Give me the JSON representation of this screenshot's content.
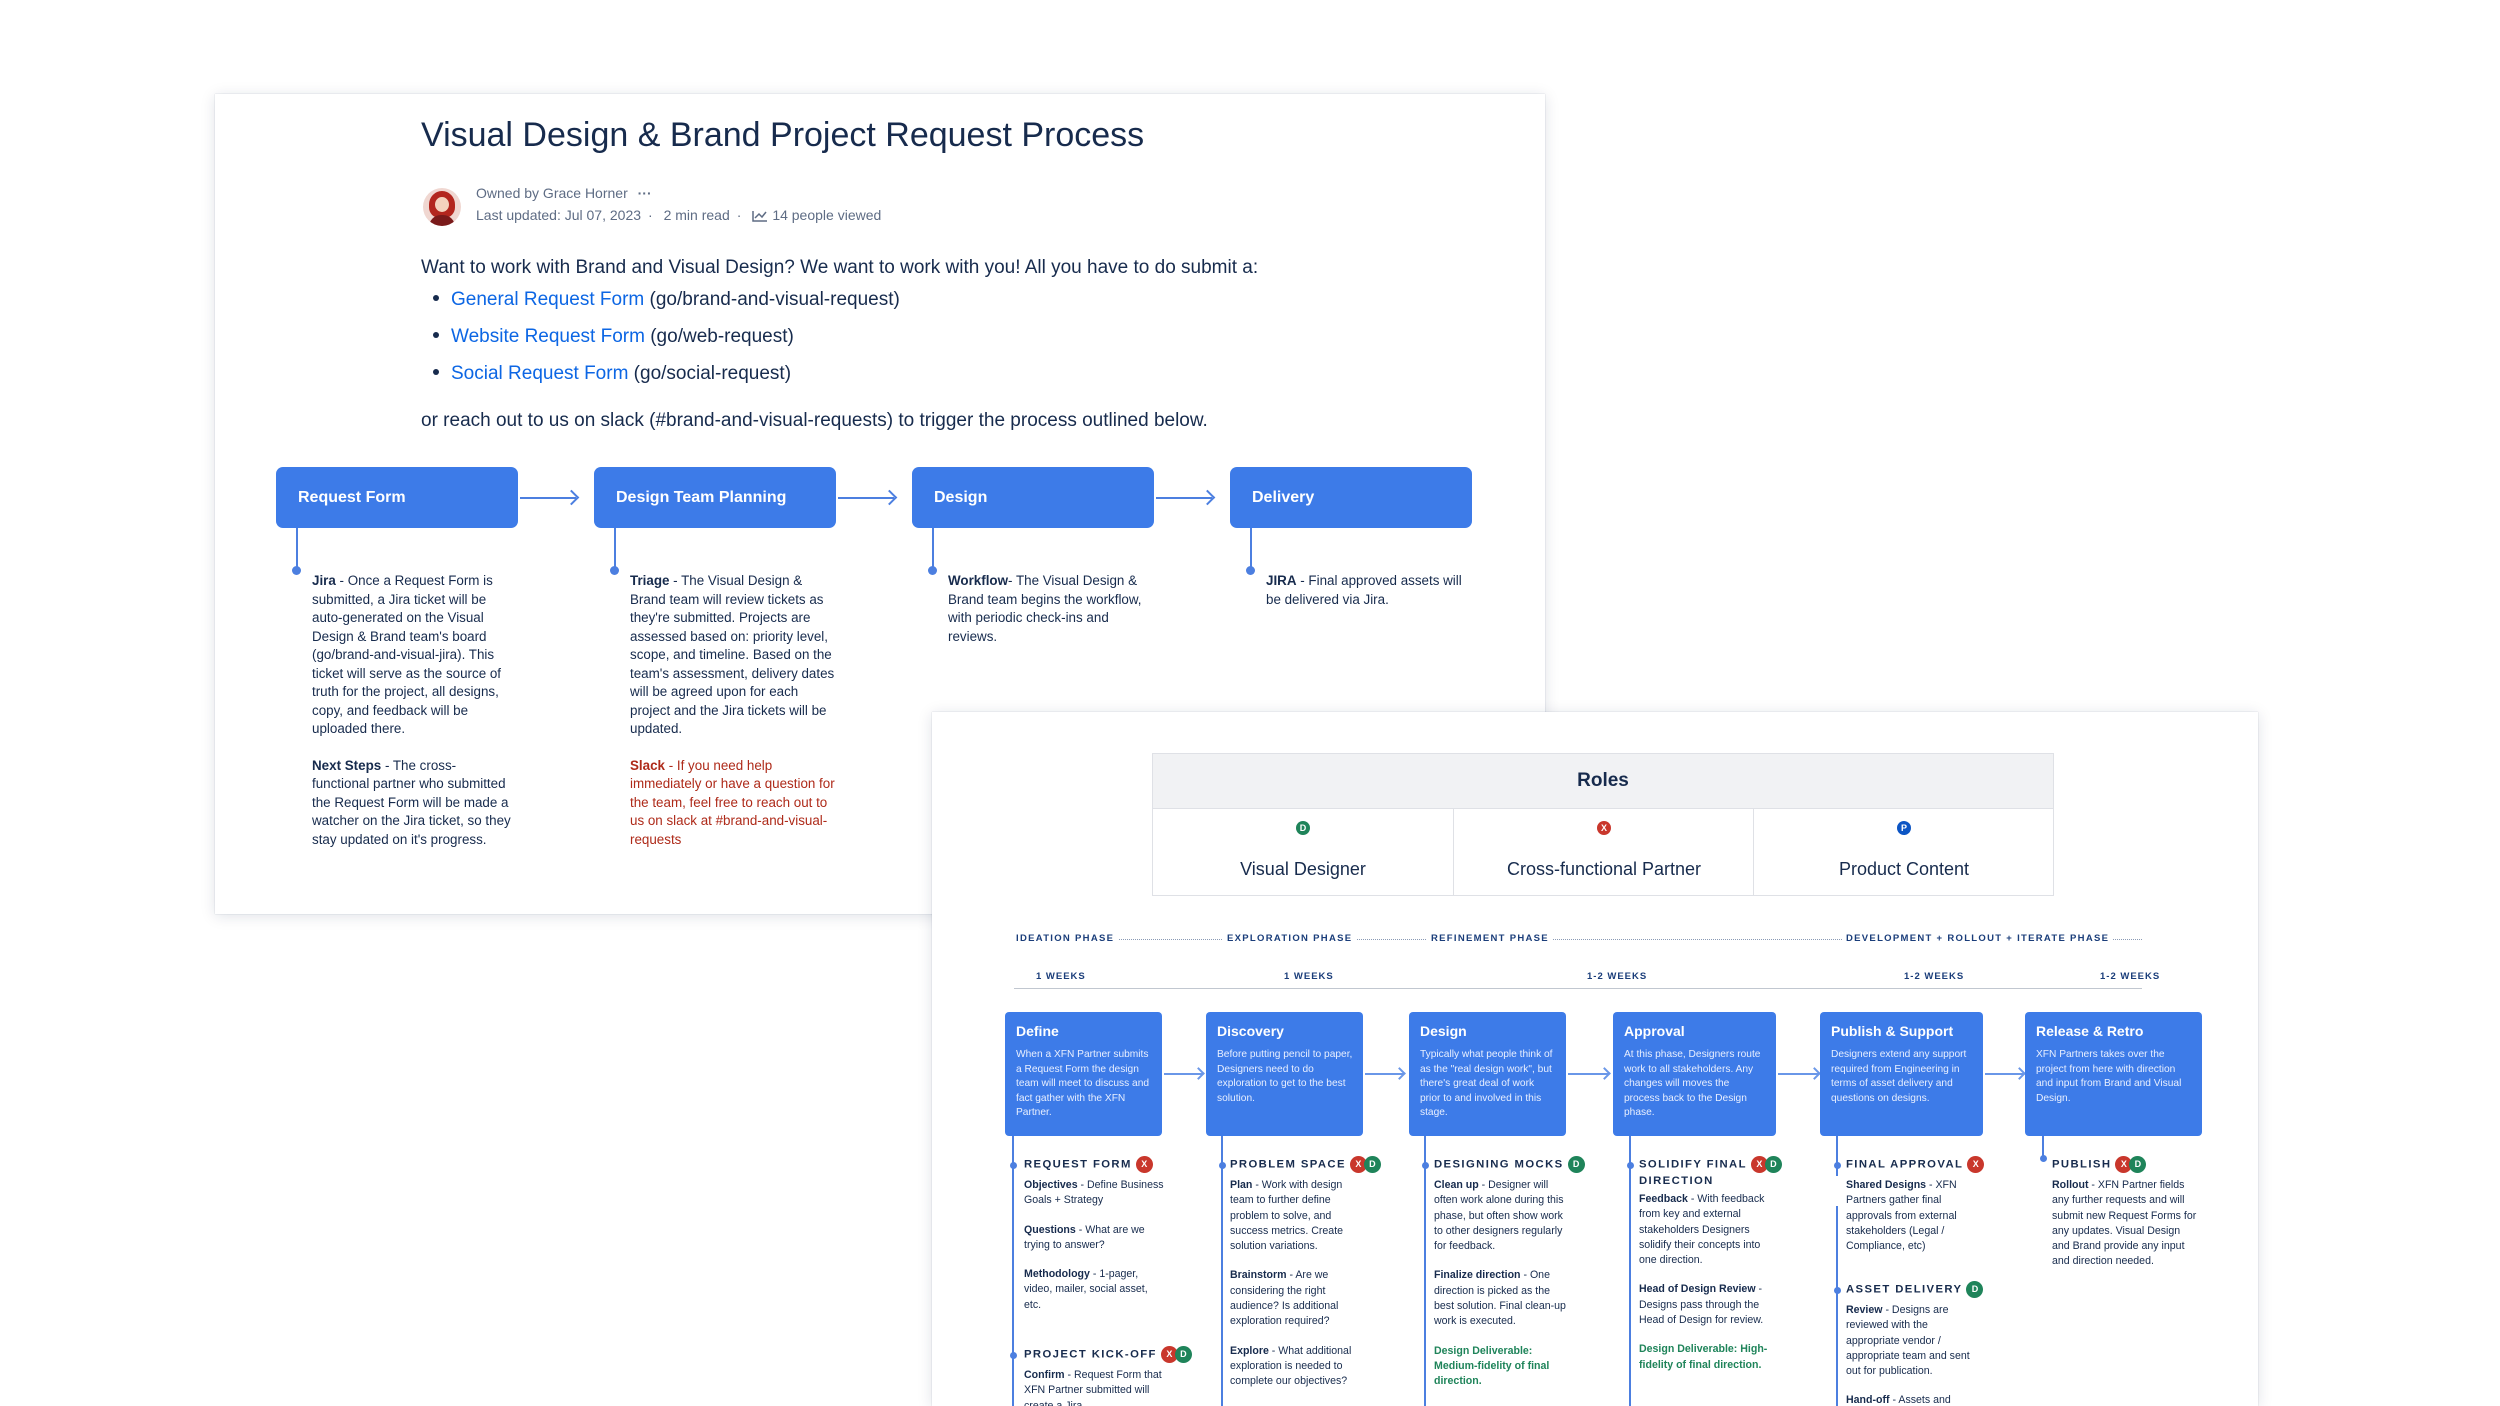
{
  "doc": {
    "title": "Visual Design & Brand Project Request Process",
    "owner": "Owned by Grace Horner",
    "owner_menu": "···",
    "updated": "Last updated: Jul 07, 2023",
    "read_time": "2 min read",
    "viewed": "14 people viewed",
    "intro": "Want to work with Brand and Visual Design? We want to work with you! All you have to do submit a:",
    "links": [
      {
        "label": "General Request Form",
        "suffix": " (go/brand-and-visual-request)"
      },
      {
        "label": "Website Request Form",
        "suffix": " (go/web-request)"
      },
      {
        "label": "Social Request Form",
        "suffix": " (go/social-request)"
      }
    ],
    "outro": "or reach out to us on slack (#brand-and-visual-requests) to trigger the process outlined below."
  },
  "flow": {
    "steps": [
      "Request Form",
      "Design Team Planning",
      "Design",
      "Delivery"
    ],
    "col1": {
      "p1_bold": "Jira",
      "p1_text": " - Once a Request Form is submitted, a Jira ticket will be auto-generated on the Visual Design & Brand team's board (go/brand-and-visual-jira). This ticket will serve as the source of truth for the project, all designs, copy, and feedback will be uploaded there.",
      "p2_bold": "Next Steps",
      "p2_text": " - The cross-functional partner who submitted the Request Form will be made a watcher on the Jira ticket, so they stay updated on it's progress."
    },
    "col2": {
      "p1_bold": "Triage",
      "p1_text": " - The Visual Design & Brand team will review tickets as they're submitted. Projects are assessed based on: priority level, scope, and timeline. Based on the team's assessment, delivery dates will be agreed upon for each project and the Jira tickets will be updated.",
      "p2_bold": "Slack",
      "p2_text": " - If you need help immediately or have a question for the team, feel free to reach out to us on slack at #brand-and-visual-requests"
    },
    "col3": {
      "p1_bold": "Workflow",
      "p1_text": "- The Visual Design & Brand team begins the workflow, with periodic check-ins and reviews."
    },
    "col4": {
      "p1_bold": "JIRA",
      "p1_text": " - Final approved assets will be delivered via Jira."
    }
  },
  "roles": {
    "title": "Roles",
    "items": [
      {
        "badge": "D",
        "label": "Visual Designer",
        "color": "#1f845a"
      },
      {
        "badge": "X",
        "label": "Cross-functional Partner",
        "color": "#c9372c"
      },
      {
        "badge": "P",
        "label": "Product Content",
        "color": "#0c55c4"
      }
    ]
  },
  "timeline": {
    "phases": [
      "IDEATION PHASE",
      "EXPLORATION PHASE",
      "REFINEMENT PHASE",
      "DEVELOPMENT + ROLLOUT + ITERATE PHASE"
    ],
    "weeks": [
      "1 WEEKS",
      "1 WEEKS",
      "1-2 WEEKS",
      "1-2 WEEKS",
      "1-2 WEEKS"
    ],
    "boxes": [
      {
        "title": "Define",
        "text": "When a XFN Partner submits a Request Form the design team will meet to discuss and fact gather with the XFN Partner."
      },
      {
        "title": "Discovery",
        "text": "Before putting pencil to paper, Designers need to do exploration to get to the best solution."
      },
      {
        "title": "Design",
        "text": "Typically what people think of as the \"real design work\", but there's great deal of work prior to and involved in this stage."
      },
      {
        "title": "Approval",
        "text": "At this phase, Designers route work to all stakeholders. Any changes will moves the process back to the Design phase."
      },
      {
        "title": "Publish & Support",
        "text": "Designers extend any support required from Engineering in terms of asset delivery and questions on designs."
      },
      {
        "title": "Release & Retro",
        "text": "XFN Partners takes over the project from here with direction and input from Brand and Visual Design."
      }
    ],
    "milestones": {
      "request_form": "REQUEST FORM",
      "kickoff": "PROJECT KICK-OFF",
      "problem_space": "PROBLEM SPACE",
      "designing_mocks": "DESIGNING MOCKS",
      "solidify": "SOLIDIFY FINAL",
      "solidify2": "DIRECTION",
      "final_approval": "FINAL APPROVAL",
      "asset_delivery": "ASSET DELIVERY",
      "publish": "PUBLISH"
    },
    "c1": {
      "a_b": "Objectives",
      "a_t": " - Define Business Goals + Strategy",
      "b_b": "Questions",
      "b_t": " - What are we trying to answer?",
      "c_b": "Methodology",
      "c_t": " - 1-pager, video, mailer, social asset, etc.",
      "d_b": "Confirm",
      "d_t": " - Request Form that XFN Partner submitted will create a Jira"
    },
    "c2": {
      "a_b": "Plan",
      "a_t": " - Work with design team to further define problem to solve, and success metrics. Create solution variations.",
      "b_b": "Brainstorm",
      "b_t": " - Are we considering the right audience? Is additional exploration required?",
      "c_b": "Explore",
      "c_t": " - What additional exploration is needed to complete our objectives?"
    },
    "c3": {
      "a_b": "Clean up",
      "a_t": " - Designer will often work alone during this phase, but often show work to other designers regularly for feedback.",
      "b_b": "Finalize direction",
      "b_t": " - One direction is picked as the best solution. Final clean-up work is executed.",
      "c_g": "Design Deliverable: Medium-fidelity of final direction."
    },
    "c4": {
      "a_b": "Feedback",
      "a_t": " - With feedback from key and external stakeholders Designers solidify their concepts into one direction.",
      "b_b": "Head of Design Review",
      "b_t": " - Designs pass through the Head of Design for review.",
      "c_g": "Design Deliverable: High-fidelity of final direction."
    },
    "c5": {
      "a_b": "Shared Designs",
      "a_t": " - XFN Partners gather final approvals from external stakeholders (Legal / Compliance, etc)",
      "b_b": "Review",
      "b_t": " - Designs are reviewed with the appropriate vendor / appropriate team and sent out for publication.",
      "c_b": "Hand-off",
      "c_t": " - Assets and"
    },
    "c6": {
      "a_b": "Rollout",
      "a_t": " - XFN Partner fields any further requests and will submit new Request Forms for any updates. Visual Design and Brand provide any input and direction needed."
    }
  }
}
